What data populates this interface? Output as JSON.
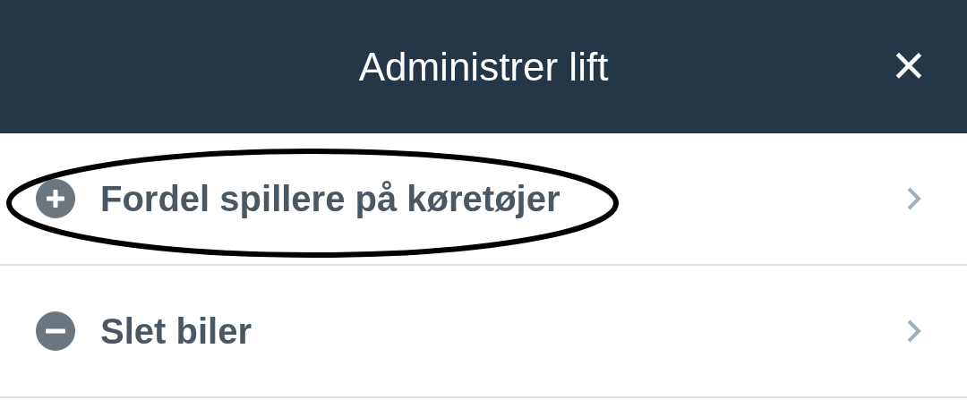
{
  "header": {
    "title": "Administrer lift",
    "close": "×"
  },
  "items": [
    {
      "label": "Fordel spillere på køretøjer",
      "kind": "add",
      "circled": true
    },
    {
      "label": "Slet biler",
      "kind": "remove",
      "circled": false
    }
  ]
}
